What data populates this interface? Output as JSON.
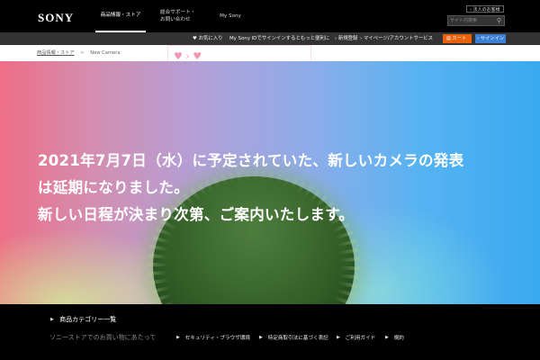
{
  "header": {
    "logo": "SONY",
    "nav": [
      {
        "label": "商品情報・ストア"
      },
      {
        "label": "総合サポート・お問い合わせ"
      },
      {
        "label": "My Sony"
      }
    ],
    "corporate_link": "法人のお客様",
    "search_placeholder": "サイト内検索",
    "search_icon": "search-icon"
  },
  "utility_bar": {
    "favorites": "お気に入り",
    "mysony_message": "My Sony IDでサインインするともっと便利に",
    "register": "新規登録",
    "mypage": "マイページ/アカウントサービス",
    "cart_label": "カート",
    "cart_count": "0",
    "signin_label": "サインイン"
  },
  "promo_banner": {
    "hearts": "♥ › ♥"
  },
  "breadcrumb": [
    {
      "label": "商品情報・ストア",
      "link": true
    },
    {
      "label": "New Camera",
      "link": false
    }
  ],
  "breadcrumb_separator": ">",
  "hero": {
    "lines": [
      "2021年7月7日（水）に予定されていた、新しいカメラの発表",
      "は延期になりました。",
      "新しい日程が決まり次第、ご案内いたします。"
    ]
  },
  "footer": {
    "category_link": "商品カテゴリー一覧",
    "shopping_heading": "ソニーストアでのお買い物にあたって",
    "links": [
      {
        "label": "セキュリティ・ブラウザ環境"
      },
      {
        "label": "特定商取引法に基づく表記"
      },
      {
        "label": "ご利用ガイド"
      },
      {
        "label": "規約"
      }
    ]
  },
  "colors": {
    "cart": "#e8610d",
    "signin": "#3b7fd6",
    "utility_bar": "#333333"
  }
}
